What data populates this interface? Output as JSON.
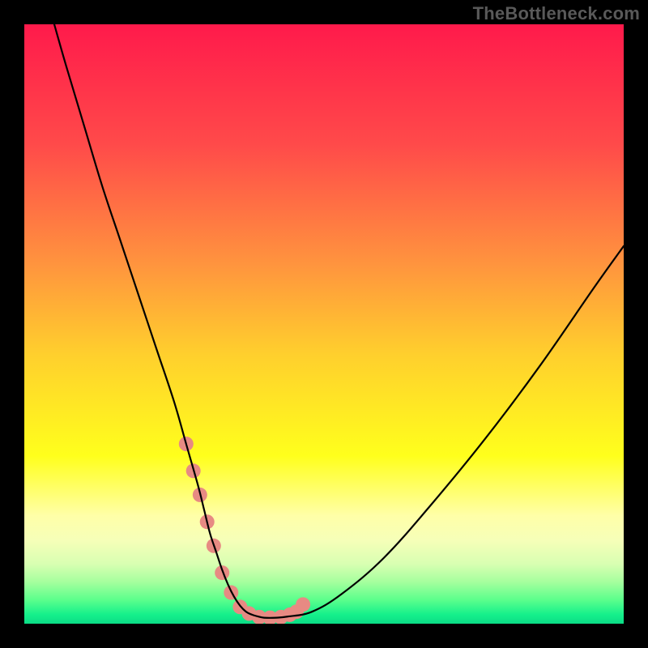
{
  "watermark": "TheBottleneck.com",
  "chart_data": {
    "type": "line",
    "title": "",
    "xlabel": "",
    "ylabel": "",
    "xlim": [
      0,
      100
    ],
    "ylim": [
      0,
      100
    ],
    "legend": false,
    "grid": false,
    "background_gradient": {
      "type": "vertical",
      "stops": [
        {
          "pos": 0.0,
          "color": "#ff1a4b"
        },
        {
          "pos": 0.2,
          "color": "#ff4a4a"
        },
        {
          "pos": 0.4,
          "color": "#ff943e"
        },
        {
          "pos": 0.55,
          "color": "#ffcf2d"
        },
        {
          "pos": 0.72,
          "color": "#ffff1c"
        },
        {
          "pos": 0.82,
          "color": "#ffffa8"
        },
        {
          "pos": 0.86,
          "color": "#f6ffb8"
        },
        {
          "pos": 0.9,
          "color": "#d9ffb2"
        },
        {
          "pos": 0.93,
          "color": "#a6ff9e"
        },
        {
          "pos": 0.96,
          "color": "#5cff8c"
        },
        {
          "pos": 0.985,
          "color": "#15f08b"
        },
        {
          "pos": 1.0,
          "color": "#0bdc86"
        }
      ]
    },
    "series": [
      {
        "name": "curve",
        "stroke": "#000000",
        "x": [
          5,
          7,
          10,
          13,
          16,
          19,
          22,
          25,
          27,
          29,
          30,
          31,
          32,
          33,
          34,
          35,
          36,
          37,
          38,
          39,
          40,
          42,
          44,
          48,
          53,
          60,
          68,
          77,
          86,
          95,
          100
        ],
        "y": [
          100,
          93,
          83,
          73,
          64,
          55,
          46,
          37,
          30,
          23,
          19,
          15,
          12,
          9,
          6.5,
          4.5,
          3,
          2,
          1.5,
          1.2,
          1,
          1,
          1.2,
          2,
          5,
          11,
          20,
          31,
          43,
          56,
          63
        ]
      }
    ],
    "markers": {
      "name": "highlight-dots",
      "color": "#e78a83",
      "radius_px": 9,
      "x": [
        27.0,
        28.2,
        29.3,
        30.5,
        31.6,
        33.0,
        34.5,
        36.0,
        37.5,
        39.2,
        41.0,
        42.8,
        44.3,
        45.4,
        46.5
      ],
      "y": [
        30.0,
        25.5,
        21.5,
        17.0,
        13.0,
        8.5,
        5.2,
        2.8,
        1.7,
        1.1,
        1.0,
        1.1,
        1.5,
        2.0,
        3.2
      ]
    }
  }
}
